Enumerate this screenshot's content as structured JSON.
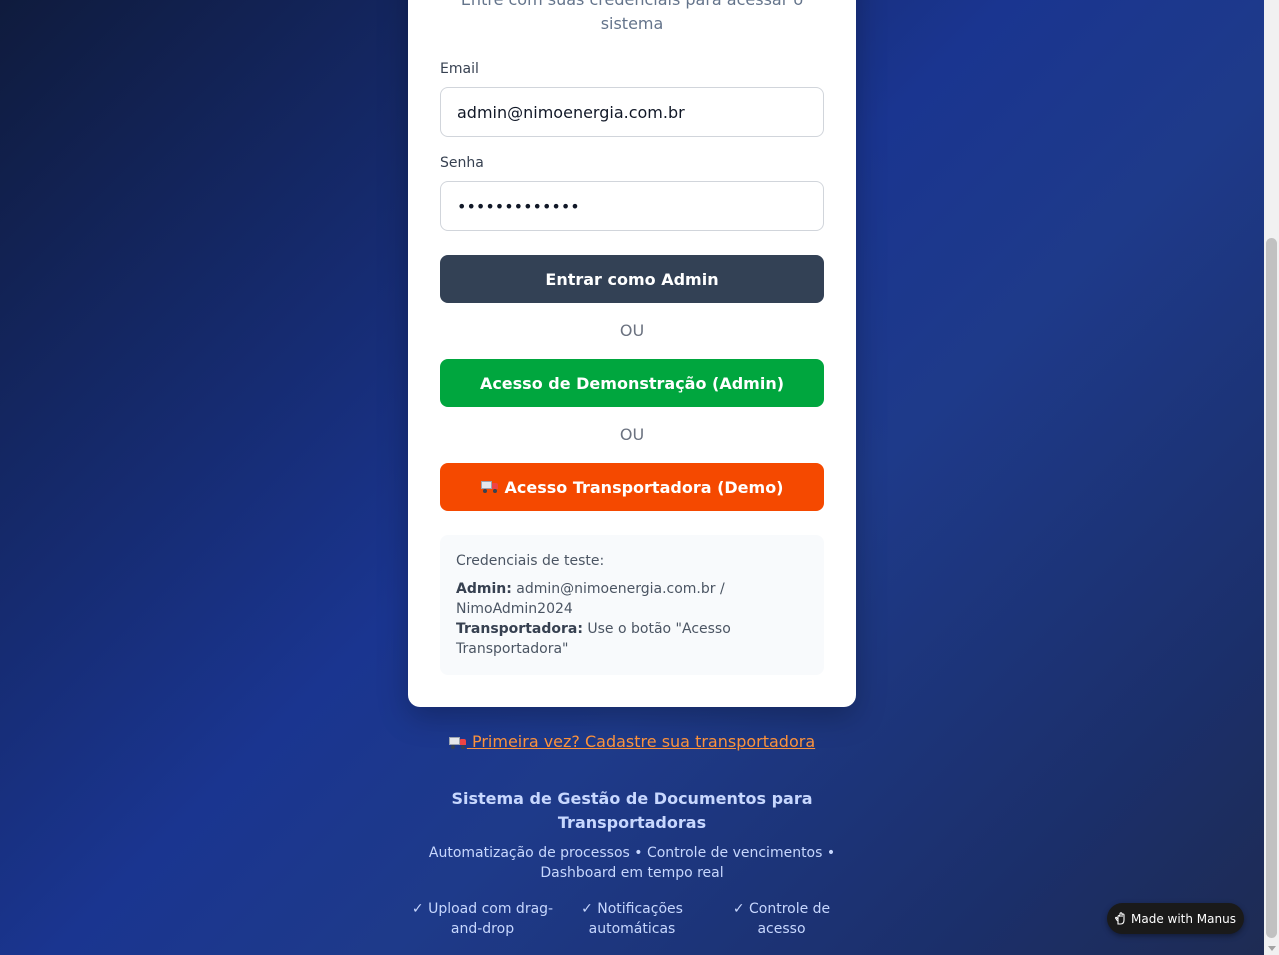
{
  "login": {
    "subtitle": "Entre com suas credenciais para acessar o sistema",
    "email_label": "Email",
    "email_value": "admin@nimoenergia.com.br",
    "password_label": "Senha",
    "password_value": "NimoAdmin2024",
    "submit_label": "Entrar como Admin",
    "or_label": "OU",
    "demo_admin_label": "Acesso de Demonstração (Admin)",
    "demo_transp_label": "Acesso Transportadora (Demo)"
  },
  "credentials": {
    "title": "Credenciais de teste:",
    "admin_key": "Admin:",
    "admin_value": "admin@nimoenergia.com.br / NimoAdmin2024",
    "transp_key": "Transportadora:",
    "transp_value": "Use o botão \"Acesso Transportadora\""
  },
  "signup_link": "Primeira vez? Cadastre sua transportadora",
  "footer": {
    "title": "Sistema de Gestão de Documentos para Transportadoras",
    "description": "Automatização de processos • Controle de vencimentos • Dashboard em tempo real",
    "features": [
      "✓ Upload com drag-and-drop",
      "✓ Notificações automáticas",
      "✓ Controle de acesso"
    ]
  },
  "badge": {
    "label": "Made with Manus"
  },
  "colors": {
    "admin_button": "#334155",
    "demo_button": "#00a63e",
    "transp_button": "#f54900",
    "link": "#fb923c"
  },
  "icons": [
    "truck-icon",
    "manus-hand-icon"
  ]
}
